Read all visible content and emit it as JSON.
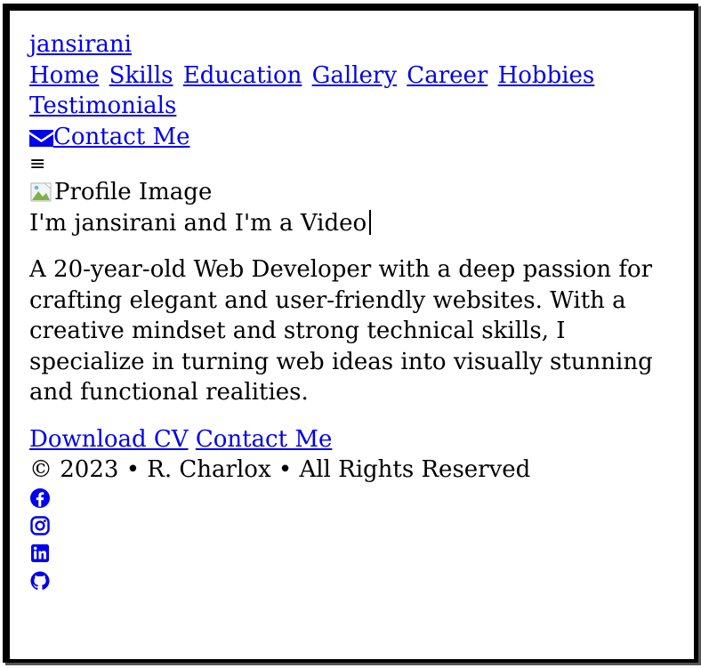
{
  "brand": "jansirani",
  "nav": {
    "items": [
      "Home",
      "Skills",
      "Education",
      "Gallery",
      "Career",
      "Hobbies"
    ],
    "testimonials": "Testimonials",
    "contact": "Contact Me",
    "menu_icon": "≡"
  },
  "hero": {
    "profile_alt": "Profile Image",
    "typing_text": "I'm jansirani and I'm a Video",
    "bio": "A 20-year-old Web Developer with a deep passion for crafting elegant and user-friendly websites. With a creative mindset and strong technical skills, I specialize in turning web ideas into visually stunning and functional realities.",
    "download_cv": "Download CV",
    "contact": "Contact Me"
  },
  "footer": {
    "copyright": "© 2023 • R. Charlox • All Rights Reserved",
    "social_icons": [
      "facebook-icon",
      "instagram-icon",
      "linkedin-icon",
      "github-icon"
    ]
  },
  "colors": {
    "link": "#0000ee",
    "text": "#000000",
    "social_icon": "#0000ee"
  }
}
